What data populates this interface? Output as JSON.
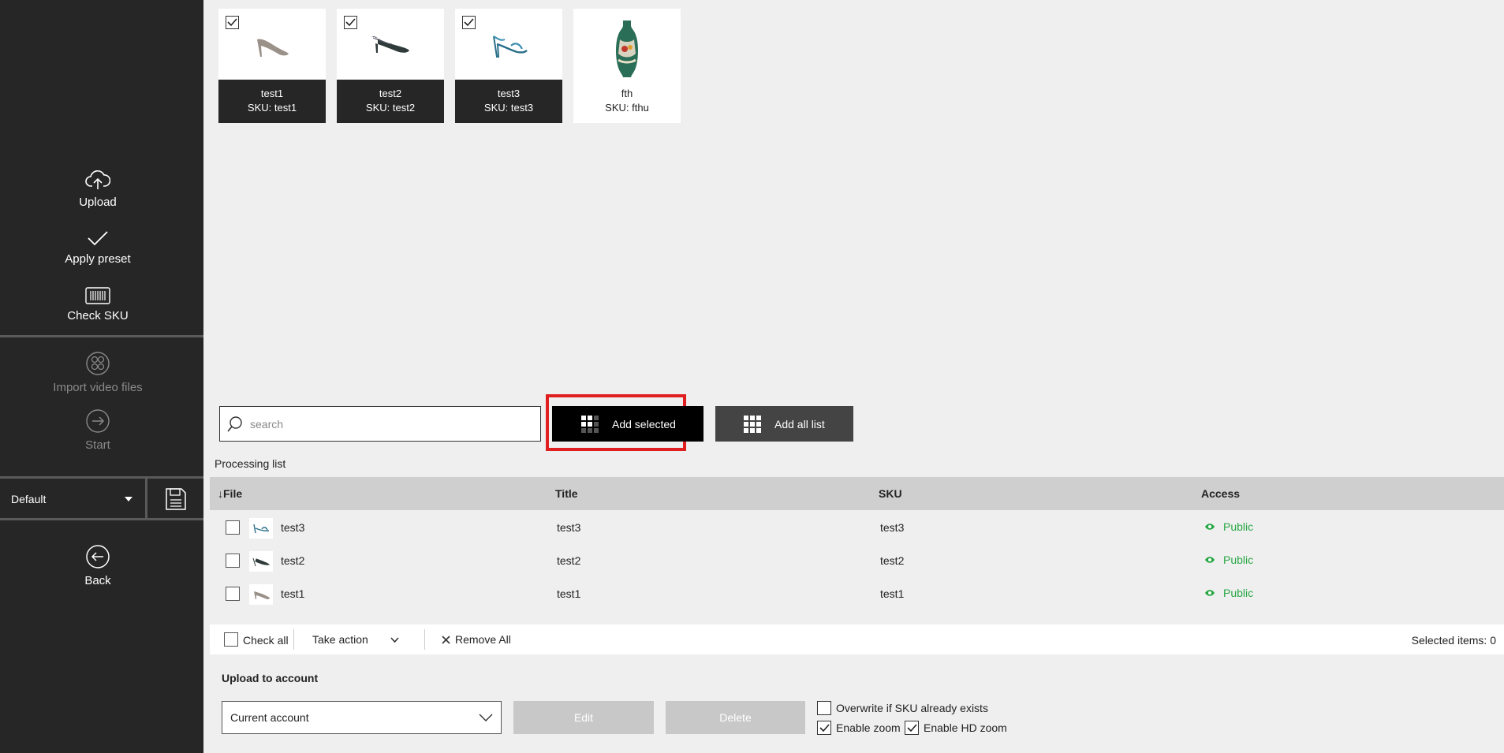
{
  "sidebar": {
    "upload_label": "Upload",
    "apply_preset_label": "Apply preset",
    "check_sku_label": "Check SKU",
    "import_video_label": "Import video files",
    "start_label": "Start",
    "preset_value": "Default",
    "back_label": "Back"
  },
  "products": [
    {
      "name": "test1",
      "sku": "SKU: test1",
      "selected": true
    },
    {
      "name": "test2",
      "sku": "SKU: test2",
      "selected": true
    },
    {
      "name": "test3",
      "sku": "SKU: test3",
      "selected": true
    },
    {
      "name": "fth",
      "sku": "SKU: fthu",
      "selected": false
    }
  ],
  "search": {
    "placeholder": "search"
  },
  "buttons": {
    "add_selected": "Add selected",
    "add_all": "Add all list"
  },
  "processing": {
    "label": "Processing list",
    "columns": {
      "file": "↓File",
      "title": "Title",
      "sku": "SKU",
      "access": "Access"
    },
    "rows": [
      {
        "file": "test3",
        "title": "test3",
        "sku": "test3",
        "access": "Public"
      },
      {
        "file": "test2",
        "title": "test2",
        "sku": "test2",
        "access": "Public"
      },
      {
        "file": "test1",
        "title": "test1",
        "sku": "test1",
        "access": "Public"
      }
    ],
    "footer": {
      "check_all": "Check all",
      "take_action": "Take action",
      "remove_all": "Remove All",
      "selected_items": "Selected items: 0"
    }
  },
  "upload": {
    "label": "Upload to account",
    "account_value": "Current account",
    "edit_label": "Edit",
    "delete_label": "Delete",
    "overwrite_label": "Overwrite if SKU already exists",
    "overwrite_checked": false,
    "enable_zoom_label": "Enable zoom",
    "enable_zoom_checked": true,
    "enable_hd_zoom_label": "Enable HD zoom",
    "enable_hd_zoom_checked": true
  },
  "colors": {
    "sidebar_bg": "#262626",
    "public_green": "#28a745",
    "highlight_red": "#e02020"
  }
}
